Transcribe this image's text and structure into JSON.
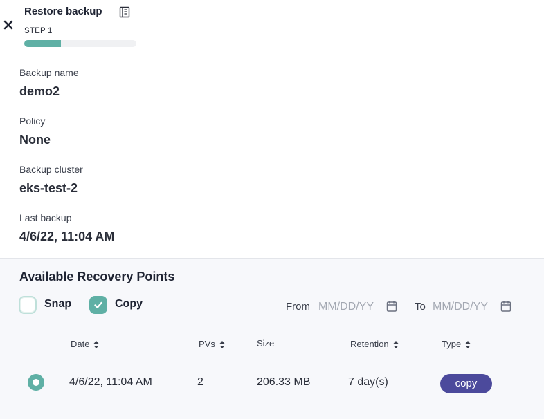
{
  "header": {
    "close_icon": "close-icon",
    "title": "Restore backup",
    "doc_icon": "document-icon",
    "step_label": "STEP 1",
    "progress_fraction": 0.33,
    "progress_color": "#5fb0a5"
  },
  "details": {
    "backup_name_label": "Backup name",
    "backup_name": "demo2",
    "policy_label": "Policy",
    "policy": "None",
    "cluster_label": "Backup cluster",
    "cluster": "eks-test-2",
    "last_backup_label": "Last backup",
    "last_backup": "4/6/22, 11:04 AM"
  },
  "recovery": {
    "title": "Available Recovery Points",
    "filters": {
      "snap_label": "Snap",
      "snap_checked": false,
      "copy_label": "Copy",
      "copy_checked": true,
      "from_label": "From",
      "from_placeholder": "MM/DD/YY",
      "to_label": "To",
      "to_placeholder": "MM/DD/YY"
    },
    "columns": {
      "date": "Date",
      "pvs": "PVs",
      "size": "Size",
      "retention": "Retention",
      "type": "Type"
    },
    "rows": [
      {
        "selected": true,
        "date": "4/6/22, 11:04 AM",
        "pvs": "2",
        "size": "206.33 MB",
        "retention": "7 day(s)",
        "type": "copy"
      }
    ],
    "accent_color": "#5fb0a5",
    "badge_color": "#4c4a9c"
  }
}
